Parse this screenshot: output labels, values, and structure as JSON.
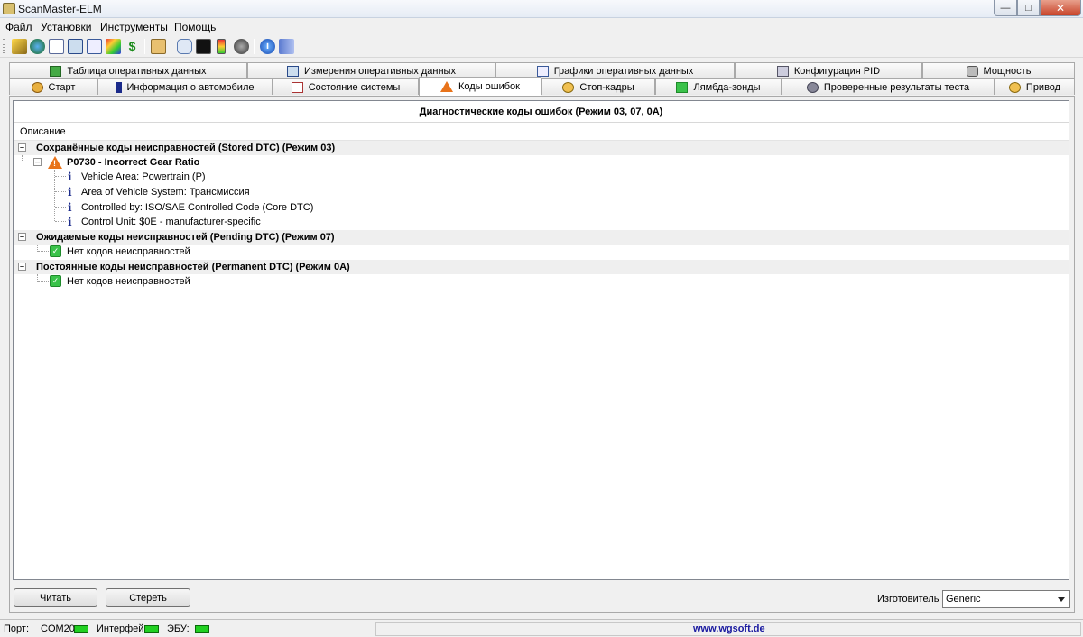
{
  "window": {
    "title": "ScanMaster-ELM"
  },
  "menu": [
    "Файл",
    "Установки",
    "Инструменты",
    "Помощь"
  ],
  "toolbar_icons": [
    "wand-icon",
    "globe-icon",
    "document-icon",
    "table-icon",
    "chart-icon",
    "colors-icon",
    "dollar-icon",
    "clipboard-icon",
    "chat-icon",
    "terminal-icon",
    "battery-icon",
    "disc-icon",
    "info-icon",
    "book-icon"
  ],
  "tabs_top": [
    {
      "label": "Таблица оперативных данных",
      "icon": "table-icon"
    },
    {
      "label": "Измерения оперативных данных",
      "icon": "grid-icon"
    },
    {
      "label": "Графики оперативных данных",
      "icon": "chart-icon"
    },
    {
      "label": "Конфигурация PID",
      "icon": "settings-icon"
    },
    {
      "label": "Мощность",
      "icon": "gauge-icon"
    }
  ],
  "tabs_bottom": [
    {
      "label": "Старт",
      "icon": "start-icon"
    },
    {
      "label": "Информация о автомобиле",
      "icon": "info-icon"
    },
    {
      "label": "Состояние системы",
      "icon": "system-icon"
    },
    {
      "label": "Коды ошибок",
      "icon": "warning-icon",
      "active": true
    },
    {
      "label": "Стоп-кадры",
      "icon": "freeze-icon"
    },
    {
      "label": "Лямбда-зонды",
      "icon": "sensor-icon"
    },
    {
      "label": "Проверенные результаты теста",
      "icon": "test-icon"
    },
    {
      "label": "Привод",
      "icon": "drive-icon"
    }
  ],
  "dtc": {
    "caption": "Диагностические коды ошибок (Режим 03, 07, 0A)",
    "column": "Описание",
    "stored": {
      "label": "Сохранённые коды неисправностей (Stored DTC) (Режим 03)",
      "code": "P0730 - Incorrect Gear Ratio",
      "details": [
        "Vehicle Area: Powertrain (P)",
        "Area of Vehicle System: Трансмиссия",
        "Controlled by: ISO/SAE Controlled Code (Core DTC)",
        "Control Unit: $0E - manufacturer-specific"
      ]
    },
    "pending": {
      "label": "Ожидаемые коды неисправностей (Pending DTC) (Режим 07)",
      "none": "Нет кодов неисправностей"
    },
    "permanent": {
      "label": "Постоянные коды неисправностей (Permanent DTC) (Режим 0A)",
      "none": "Нет кодов неисправностей"
    }
  },
  "buttons": {
    "read": "Читать",
    "clear": "Стереть"
  },
  "manufacturer": {
    "label": "Изготовитель",
    "value": "Generic"
  },
  "status": {
    "port_label": "Порт:",
    "port_value": "COM20",
    "interface_label": "Интерфейс:",
    "ecu_label": "ЭБУ:",
    "url": "www.wgsoft.de",
    "led_color": "#22d022"
  }
}
